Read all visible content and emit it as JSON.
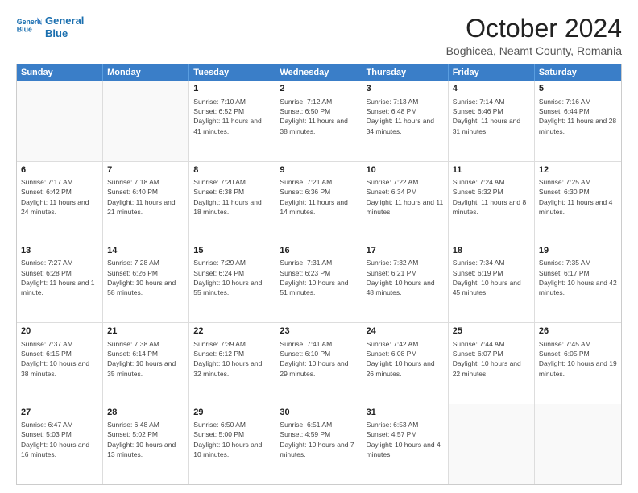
{
  "logo": {
    "line1": "General",
    "line2": "Blue"
  },
  "title": "October 2024",
  "location": "Boghicea, Neamt County, Romania",
  "days_header": [
    "Sunday",
    "Monday",
    "Tuesday",
    "Wednesday",
    "Thursday",
    "Friday",
    "Saturday"
  ],
  "weeks": [
    [
      {
        "day": "",
        "info": ""
      },
      {
        "day": "",
        "info": ""
      },
      {
        "day": "1",
        "info": "Sunrise: 7:10 AM\nSunset: 6:52 PM\nDaylight: 11 hours and 41 minutes."
      },
      {
        "day": "2",
        "info": "Sunrise: 7:12 AM\nSunset: 6:50 PM\nDaylight: 11 hours and 38 minutes."
      },
      {
        "day": "3",
        "info": "Sunrise: 7:13 AM\nSunset: 6:48 PM\nDaylight: 11 hours and 34 minutes."
      },
      {
        "day": "4",
        "info": "Sunrise: 7:14 AM\nSunset: 6:46 PM\nDaylight: 11 hours and 31 minutes."
      },
      {
        "day": "5",
        "info": "Sunrise: 7:16 AM\nSunset: 6:44 PM\nDaylight: 11 hours and 28 minutes."
      }
    ],
    [
      {
        "day": "6",
        "info": "Sunrise: 7:17 AM\nSunset: 6:42 PM\nDaylight: 11 hours and 24 minutes."
      },
      {
        "day": "7",
        "info": "Sunrise: 7:18 AM\nSunset: 6:40 PM\nDaylight: 11 hours and 21 minutes."
      },
      {
        "day": "8",
        "info": "Sunrise: 7:20 AM\nSunset: 6:38 PM\nDaylight: 11 hours and 18 minutes."
      },
      {
        "day": "9",
        "info": "Sunrise: 7:21 AM\nSunset: 6:36 PM\nDaylight: 11 hours and 14 minutes."
      },
      {
        "day": "10",
        "info": "Sunrise: 7:22 AM\nSunset: 6:34 PM\nDaylight: 11 hours and 11 minutes."
      },
      {
        "day": "11",
        "info": "Sunrise: 7:24 AM\nSunset: 6:32 PM\nDaylight: 11 hours and 8 minutes."
      },
      {
        "day": "12",
        "info": "Sunrise: 7:25 AM\nSunset: 6:30 PM\nDaylight: 11 hours and 4 minutes."
      }
    ],
    [
      {
        "day": "13",
        "info": "Sunrise: 7:27 AM\nSunset: 6:28 PM\nDaylight: 11 hours and 1 minute."
      },
      {
        "day": "14",
        "info": "Sunrise: 7:28 AM\nSunset: 6:26 PM\nDaylight: 10 hours and 58 minutes."
      },
      {
        "day": "15",
        "info": "Sunrise: 7:29 AM\nSunset: 6:24 PM\nDaylight: 10 hours and 55 minutes."
      },
      {
        "day": "16",
        "info": "Sunrise: 7:31 AM\nSunset: 6:23 PM\nDaylight: 10 hours and 51 minutes."
      },
      {
        "day": "17",
        "info": "Sunrise: 7:32 AM\nSunset: 6:21 PM\nDaylight: 10 hours and 48 minutes."
      },
      {
        "day": "18",
        "info": "Sunrise: 7:34 AM\nSunset: 6:19 PM\nDaylight: 10 hours and 45 minutes."
      },
      {
        "day": "19",
        "info": "Sunrise: 7:35 AM\nSunset: 6:17 PM\nDaylight: 10 hours and 42 minutes."
      }
    ],
    [
      {
        "day": "20",
        "info": "Sunrise: 7:37 AM\nSunset: 6:15 PM\nDaylight: 10 hours and 38 minutes."
      },
      {
        "day": "21",
        "info": "Sunrise: 7:38 AM\nSunset: 6:14 PM\nDaylight: 10 hours and 35 minutes."
      },
      {
        "day": "22",
        "info": "Sunrise: 7:39 AM\nSunset: 6:12 PM\nDaylight: 10 hours and 32 minutes."
      },
      {
        "day": "23",
        "info": "Sunrise: 7:41 AM\nSunset: 6:10 PM\nDaylight: 10 hours and 29 minutes."
      },
      {
        "day": "24",
        "info": "Sunrise: 7:42 AM\nSunset: 6:08 PM\nDaylight: 10 hours and 26 minutes."
      },
      {
        "day": "25",
        "info": "Sunrise: 7:44 AM\nSunset: 6:07 PM\nDaylight: 10 hours and 22 minutes."
      },
      {
        "day": "26",
        "info": "Sunrise: 7:45 AM\nSunset: 6:05 PM\nDaylight: 10 hours and 19 minutes."
      }
    ],
    [
      {
        "day": "27",
        "info": "Sunrise: 6:47 AM\nSunset: 5:03 PM\nDaylight: 10 hours and 16 minutes."
      },
      {
        "day": "28",
        "info": "Sunrise: 6:48 AM\nSunset: 5:02 PM\nDaylight: 10 hours and 13 minutes."
      },
      {
        "day": "29",
        "info": "Sunrise: 6:50 AM\nSunset: 5:00 PM\nDaylight: 10 hours and 10 minutes."
      },
      {
        "day": "30",
        "info": "Sunrise: 6:51 AM\nSunset: 4:59 PM\nDaylight: 10 hours and 7 minutes."
      },
      {
        "day": "31",
        "info": "Sunrise: 6:53 AM\nSunset: 4:57 PM\nDaylight: 10 hours and 4 minutes."
      },
      {
        "day": "",
        "info": ""
      },
      {
        "day": "",
        "info": ""
      }
    ]
  ]
}
